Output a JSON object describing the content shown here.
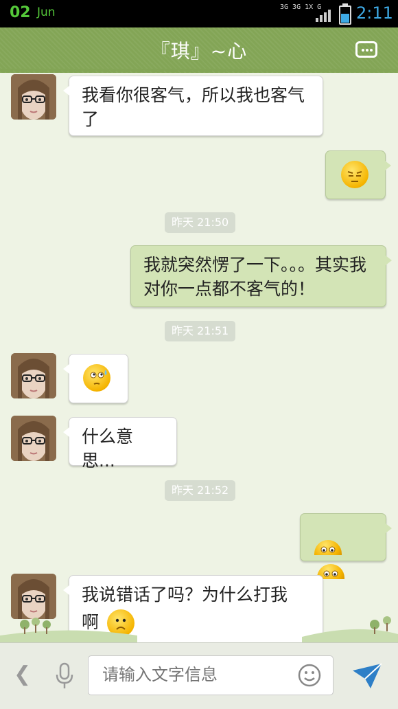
{
  "status_bar": {
    "date": "02",
    "month": "Jun",
    "network": "3G 3G 1X G",
    "time": "2:11",
    "battery_level_pct": 60
  },
  "header": {
    "title": "『琪』~心",
    "menu_icon": "more-options-icon"
  },
  "messages": [
    {
      "side": "left",
      "text": "我看你很客气，所以我也客气了"
    },
    {
      "side": "right",
      "emoji": "smirk-face"
    },
    {
      "timestamp": "昨天 21:50"
    },
    {
      "side": "right",
      "text": "我就突然愣了一下。。。其实我对你一点都不客气的！"
    },
    {
      "timestamp": "昨天 21:51"
    },
    {
      "side": "left",
      "emoji": "sweat-face"
    },
    {
      "side": "left",
      "text": "什么意思..."
    },
    {
      "timestamp": "昨天 21:52"
    },
    {
      "side": "right",
      "emoji": "peeking-faces"
    },
    {
      "side": "left",
      "text": "我说错话了吗？为什么打我",
      "text2": "啊"
    }
  ],
  "input_bar": {
    "placeholder": "请输入文字信息",
    "back_icon": "chevron-left-icon",
    "voice_icon": "microphone-icon",
    "emoji_icon": "smiley-icon",
    "send_icon": "send-icon"
  },
  "colors": {
    "header": "#83a556",
    "right_bubble": "#d3e4b6",
    "accent_blue": "#3ea9e4",
    "background": "#eef3e4"
  }
}
